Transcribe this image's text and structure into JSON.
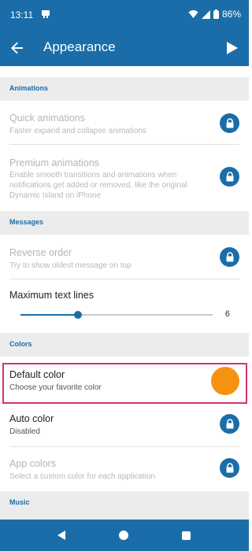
{
  "status_bar": {
    "time": "13:11",
    "battery": "86%"
  },
  "app_bar": {
    "title": "Appearance"
  },
  "sections": {
    "animations": "Animations",
    "messages": "Messages",
    "colors": "Colors",
    "music": "Music"
  },
  "rows": {
    "quick_animations": {
      "title": "Quick animations",
      "subtitle": "Faster expand and collapse animations"
    },
    "premium_animations": {
      "title": "Premium animations",
      "subtitle_1": "Enable smooth transitions and animations when",
      "subtitle_2": "notifications get added or removed, like the original",
      "subtitle_3": "Dynamic Island on iPhone"
    },
    "reverse_order": {
      "title": "Reverse order",
      "subtitle": "Try to show oldest message on top"
    },
    "max_text_lines": {
      "title": "Maximum text lines",
      "value": "6",
      "fraction": 0.3
    },
    "default_color": {
      "title": "Default color",
      "subtitle": "Choose your favorite color",
      "color": "#f59311"
    },
    "auto_color": {
      "title": "Auto color",
      "subtitle": "Disabled"
    },
    "app_colors": {
      "title": "App colors",
      "subtitle": "Select a custom color for each application"
    }
  },
  "colors": {
    "primary": "#1a6da8",
    "accent": "#f59311",
    "highlight": "#d6336c"
  }
}
